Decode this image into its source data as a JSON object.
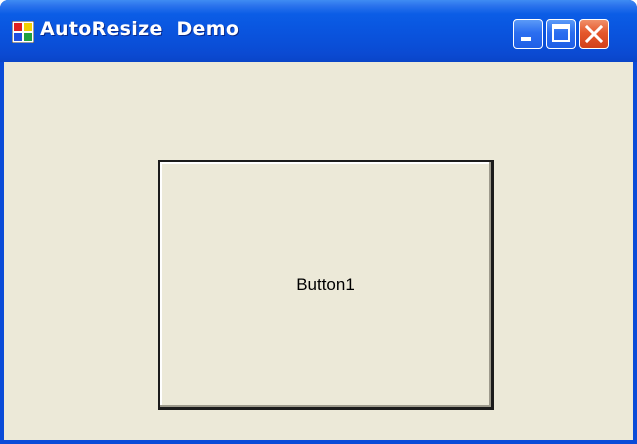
{
  "window": {
    "title": "AutoResize  Demo",
    "title_icon": "winforms-app-icon",
    "controls": {
      "minimize_icon": "minimize-icon",
      "maximize_icon": "maximize-icon",
      "close_icon": "close-icon"
    }
  },
  "content": {
    "button1_label": "Button1"
  },
  "colors": {
    "titlebar": "#0a55df",
    "client_background": "#ece9d8",
    "close_button": "#e5582c"
  }
}
